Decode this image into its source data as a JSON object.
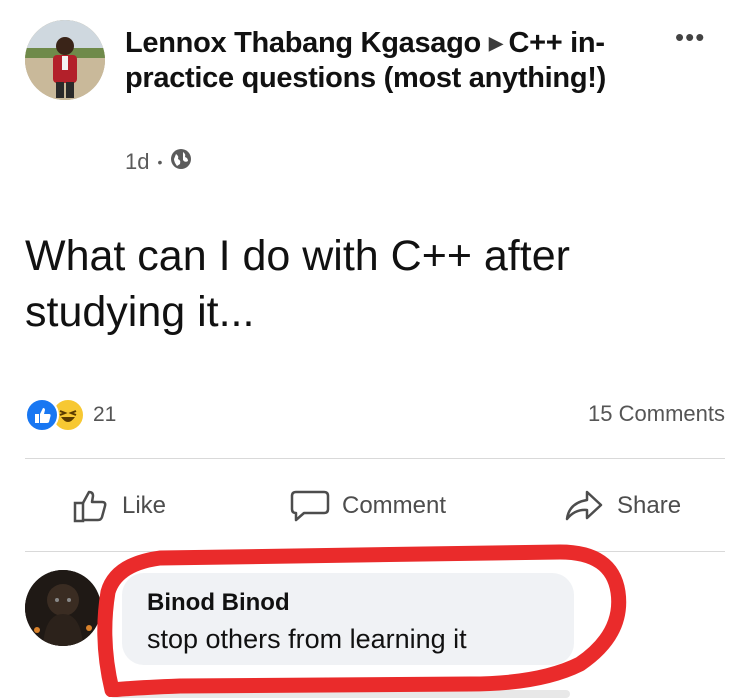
{
  "post": {
    "author": "Lennox Thabang Kgasago",
    "group": "C++ in-practice questions (most anything!)",
    "time": "1d",
    "body_line1": "What can I do with C++ after",
    "body_line2": "studying it...",
    "reaction_count": "21",
    "comments_count": "15 Comments",
    "privacy_icon": "globe-icon",
    "reaction_icons": [
      "like-reaction-icon",
      "haha-reaction-icon"
    ]
  },
  "actions": {
    "like": "Like",
    "comment": "Comment",
    "share": "Share"
  },
  "comment": {
    "author": "Binod Binod",
    "text": "stop others from learning it"
  },
  "colors": {
    "like_blue": "#1877f2",
    "annotation_red": "#ea2b2b",
    "bubble_bg": "#f0f2f5"
  }
}
